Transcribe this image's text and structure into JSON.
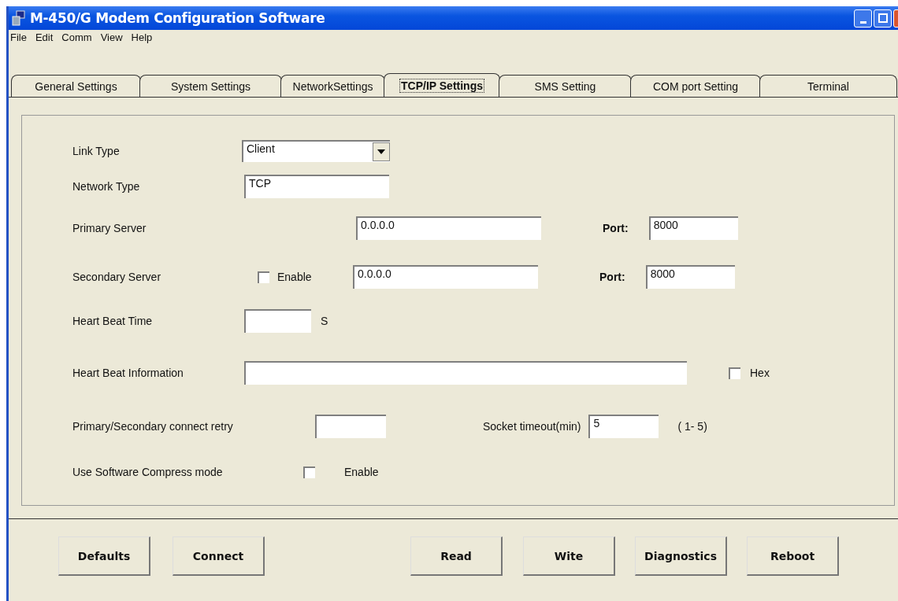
{
  "window": {
    "title": "M-450/G Modem Configuration Software"
  },
  "menu": [
    "File",
    "Edit",
    "Comm",
    "View",
    "Help"
  ],
  "tabs": [
    {
      "label": "General Settings",
      "selected": false
    },
    {
      "label": "System Settings",
      "selected": false
    },
    {
      "label": "NetworkSettings",
      "selected": false
    },
    {
      "label": "TCP/IP Settings",
      "selected": true
    },
    {
      "label": "SMS Setting",
      "selected": false
    },
    {
      "label": "COM port Setting",
      "selected": false
    },
    {
      "label": "Terminal",
      "selected": false
    }
  ],
  "form": {
    "link_type": {
      "label": "Link Type",
      "value": "Client"
    },
    "network_type": {
      "label": "Network Type",
      "value": "TCP"
    },
    "primary_server": {
      "label": "Primary Server",
      "value": "0.0.0.0",
      "port_label": "Port:",
      "port": "8000"
    },
    "secondary_server": {
      "label": "Secondary Server",
      "enable_label": "Enable",
      "checked": false,
      "value": "0.0.0.0",
      "port_label": "Port:",
      "port": "8000"
    },
    "heart_beat_time": {
      "label": "Heart Beat Time",
      "unit": "S"
    },
    "heart_beat_information": {
      "label": "Heart Beat Information",
      "hex_label": "Hex",
      "hex_checked": false
    },
    "connect_retry": {
      "label": "Primary/Secondary connect retry"
    },
    "socket_timeout": {
      "label": "Socket timeout(min)",
      "value": "5",
      "range": "( 1- 5)"
    },
    "compress_mode": {
      "label": "Use Software Compress mode",
      "enable_label": "Enable",
      "checked": false
    }
  },
  "buttons": [
    "Defaults",
    "Connect",
    "Read",
    "Wite",
    "Diagnostics",
    "Reboot"
  ]
}
